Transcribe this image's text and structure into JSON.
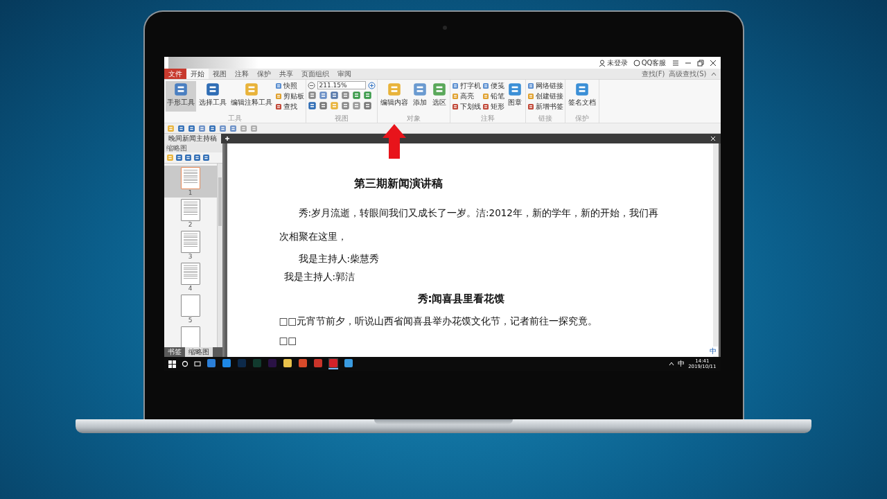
{
  "title_bar": {
    "user": "未登录",
    "support": "QQ客服"
  },
  "tabs": [
    {
      "label": "文件",
      "kind": "file",
      "selected": false
    },
    {
      "label": "开始",
      "kind": "tab",
      "selected": true
    },
    {
      "label": "视图",
      "kind": "tab",
      "selected": false
    },
    {
      "label": "注释",
      "kind": "tab",
      "selected": false
    },
    {
      "label": "保护",
      "kind": "tab",
      "selected": false
    },
    {
      "label": "共享",
      "kind": "tab",
      "selected": false
    },
    {
      "label": "页面组织",
      "kind": "tab",
      "selected": false
    },
    {
      "label": "审阅",
      "kind": "tab",
      "selected": false
    }
  ],
  "search_buttons": [
    "查找(F)",
    "高级查找(S)"
  ],
  "ribbon": {
    "groups": [
      {
        "label": "工具",
        "items": [
          {
            "kind": "large",
            "label": "手形工具",
            "selected": true
          },
          {
            "kind": "large",
            "label": "选择工具",
            "selected": false
          },
          {
            "kind": "large",
            "label": "编辑注释工具",
            "selected": false
          },
          {
            "kind": "stack",
            "labels": [
              "快照",
              "剪贴板",
              "查找"
            ]
          }
        ]
      },
      {
        "label": "视图",
        "items": [
          {
            "kind": "zoom",
            "value": "211.15%"
          }
        ]
      },
      {
        "label": "对象",
        "items": [
          {
            "kind": "large",
            "label": "编辑内容",
            "selected": false
          },
          {
            "kind": "large",
            "label": "添加",
            "selected": false
          },
          {
            "kind": "large",
            "label": "选区",
            "selected": false
          }
        ]
      },
      {
        "label": "注释",
        "items": [
          {
            "kind": "stack",
            "labels": [
              "打字机",
              "高亮",
              "下划线"
            ]
          },
          {
            "kind": "stack",
            "labels": [
              "便笺",
              "铅笔",
              "矩形"
            ]
          },
          {
            "kind": "large",
            "label": "图章",
            "selected": false
          }
        ]
      },
      {
        "label": "链接",
        "items": [
          {
            "kind": "stack",
            "labels": [
              "网络链接",
              "创建链接",
              "新增书签"
            ]
          }
        ]
      },
      {
        "label": "保护",
        "items": [
          {
            "kind": "large",
            "label": "签名文档",
            "selected": false
          }
        ]
      }
    ]
  },
  "document_tab": {
    "title": "晚间新闻主持稿"
  },
  "side_panel": {
    "title": "缩略图",
    "thumbnails": [
      {
        "page": "1",
        "kind": "text",
        "selected": true
      },
      {
        "page": "2",
        "kind": "text",
        "selected": false
      },
      {
        "page": "3",
        "kind": "text",
        "selected": false
      },
      {
        "page": "4",
        "kind": "text",
        "selected": false
      },
      {
        "page": "5",
        "kind": "blank",
        "selected": false
      },
      {
        "kind": "blank",
        "selected": false
      }
    ],
    "tabs": [
      {
        "label": "书签",
        "selected": false
      },
      {
        "label": "缩略图",
        "selected": true
      }
    ]
  },
  "document": {
    "blocks": [
      {
        "kind": "title",
        "text": "第三期新闻演讲稿"
      },
      {
        "kind": "paragraph",
        "text": "秀:岁月流逝，转眼间我们又成长了一岁。洁:2012年，新的学年，新的开始，我们再次相聚在这里，"
      },
      {
        "kind": "host",
        "text": "我是主持人:柴慧秀"
      },
      {
        "kind": "host2",
        "text": "我是主持人:郭洁"
      },
      {
        "kind": "subtitle",
        "text": "秀:闻喜县里看花馍"
      },
      {
        "kind": "plain",
        "text": "□□元宵节前夕，听说山西省闻喜县举办花馍文化节，记者前往一探究竟。"
      },
      {
        "kind": "plain",
        "text": "□□"
      }
    ]
  },
  "ime_bar": {
    "mode": "中"
  },
  "taskbar": {
    "apps": [
      {
        "color": "#2b7fd8",
        "selected": false
      },
      {
        "color": "#1e88e5",
        "selected": false
      },
      {
        "color": "#0d2a4a",
        "selected": false
      },
      {
        "color": "#113a2e",
        "selected": false
      },
      {
        "color": "#2a1245",
        "selected": false
      },
      {
        "color": "#e8c14a",
        "selected": false
      },
      {
        "color": "#d84a2a",
        "selected": false
      },
      {
        "color": "#c9342a",
        "selected": false
      },
      {
        "color": "#d2232a",
        "selected": true
      },
      {
        "color": "#3a9be0",
        "selected": false
      }
    ],
    "ime": "中",
    "time": "14:41",
    "date": "2019/10/11"
  }
}
